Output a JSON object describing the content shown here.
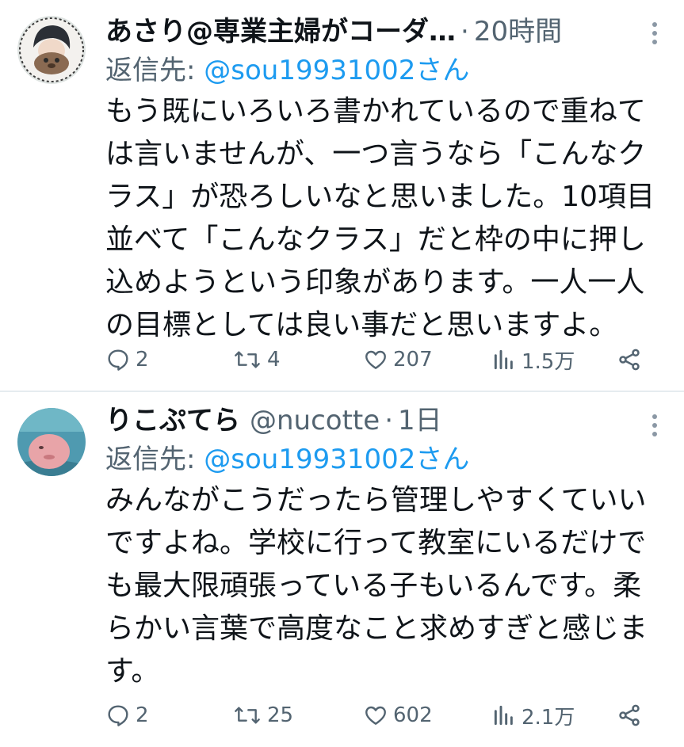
{
  "tweets": [
    {
      "name": "あさり@専業主婦がコーダ…",
      "handle": "",
      "dot": "·",
      "time": "20時間",
      "reply_prefix": "返信先: ",
      "reply_to": "@sou19931002さん",
      "text": "もう既にいろいろ書かれているので重ねては言いませんが、一つ言うなら「こんなクラス」が恐ろしいなと思いました。10項目並べて「こんなクラス」だと枠の中に押し込めようという印象があります。一人一人の目標としては良い事だと思いますよ。",
      "lines": [
        "もう既にいろいろ書かれているので重ねて",
        "は言いませんが、一つ言うなら「こんなク",
        "ラス」が恐ろしいなと思いました。10項目",
        "並べて「こんなクラス」だと枠の中に押し",
        "込めようという印象があります。一人一人",
        "の目標としては良い事だと思いますよ。"
      ],
      "replies": "2",
      "retweets": "4",
      "likes": "207",
      "views": "1.5万"
    },
    {
      "name": "りこぷてら",
      "handle": "@nucotte",
      "dot": "·",
      "time": "1日",
      "reply_prefix": "返信先: ",
      "reply_to": "@sou19931002さん",
      "lines": [
        "みんながこうだったら管理しやすくていい",
        "ですよね。学校に行って教室にいるだけで",
        "も最大限頑張っている子もいるんです。柔",
        "らかい言葉で高度なこと求めすぎと感じま",
        "す。"
      ],
      "replies": "2",
      "retweets": "25",
      "likes": "602",
      "views": "2.1万"
    }
  ],
  "icons": [
    "reply-icon",
    "retweet-icon",
    "like-icon",
    "views-icon",
    "share-icon",
    "more-icon"
  ],
  "colors": {
    "text": "#0f1419",
    "muted": "#536471",
    "link": "#1d9bf0",
    "divider": "#e6ecf0"
  }
}
